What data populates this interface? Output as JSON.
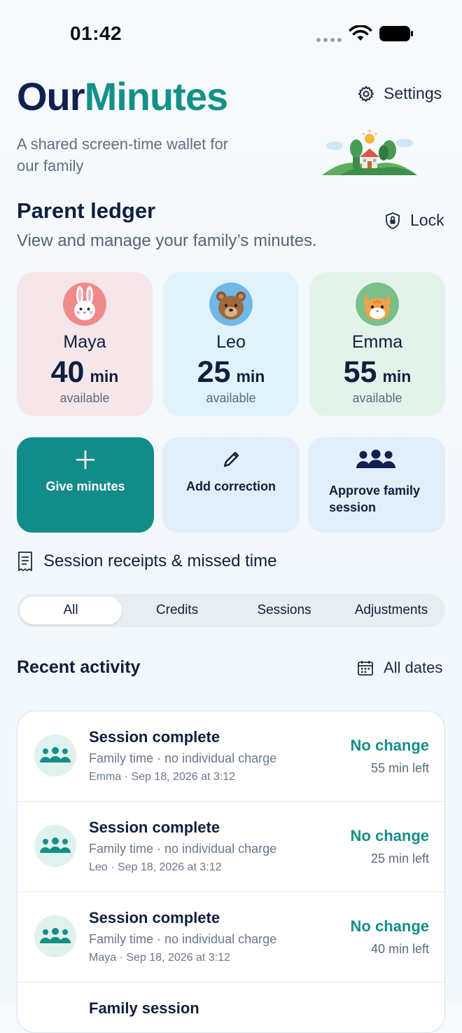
{
  "status_bar": {
    "time": "01:42"
  },
  "header": {
    "brand_our": "Our",
    "brand_minutes": "Minutes",
    "settings_label": "Settings",
    "tagline": "A shared screen-time wallet for our family"
  },
  "ledger": {
    "title": "Parent ledger",
    "subtitle": "View and manage your family’s minutes.",
    "lock_label": "Lock"
  },
  "kids": [
    {
      "name": "Maya",
      "minutes": "40",
      "unit": "min",
      "status": "available",
      "avatar": "bunny-avatar",
      "card_color": "#f5e6ea",
      "avatar_bg": "#f08a8a"
    },
    {
      "name": "Leo",
      "minutes": "25",
      "unit": "min",
      "status": "available",
      "avatar": "bear-avatar",
      "card_color": "#e0f2fa",
      "avatar_bg": "#6fb8e8"
    },
    {
      "name": "Emma",
      "minutes": "55",
      "unit": "min",
      "status": "available",
      "avatar": "cat-avatar",
      "card_color": "#e3f3ea",
      "avatar_bg": "#7bbf8a"
    }
  ],
  "actions": {
    "give": "Give minutes",
    "correction": "Add correction",
    "approve": "Approve family session"
  },
  "receipts_label": "Session receipts & missed time",
  "filter_tabs": [
    "All",
    "Credits",
    "Sessions",
    "Adjustments"
  ],
  "active_tab": "All",
  "recent": {
    "title": "Recent activity",
    "date_filter": "All dates"
  },
  "activity": [
    {
      "title": "Session complete",
      "detail": "Family time · no individual charge",
      "meta": "Emma · Sep 18, 2026 at 3:12",
      "change": "No change",
      "remaining": "55 min left"
    },
    {
      "title": "Session complete",
      "detail": "Family time · no individual charge",
      "meta": "Leo · Sep 18, 2026 at 3:12",
      "change": "No change",
      "remaining": "25 min left"
    },
    {
      "title": "Session complete",
      "detail": "Family time · no individual charge",
      "meta": "Maya · Sep 18, 2026 at 3:12",
      "change": "No change",
      "remaining": "40 min left"
    },
    {
      "title": "Family session",
      "detail": "",
      "meta": "",
      "change": "",
      "remaining": ""
    }
  ],
  "colors": {
    "brand_dark": "#102150",
    "brand_teal": "#159089",
    "primary_button": "#128c88",
    "secondary_button": "#e2eefa"
  }
}
